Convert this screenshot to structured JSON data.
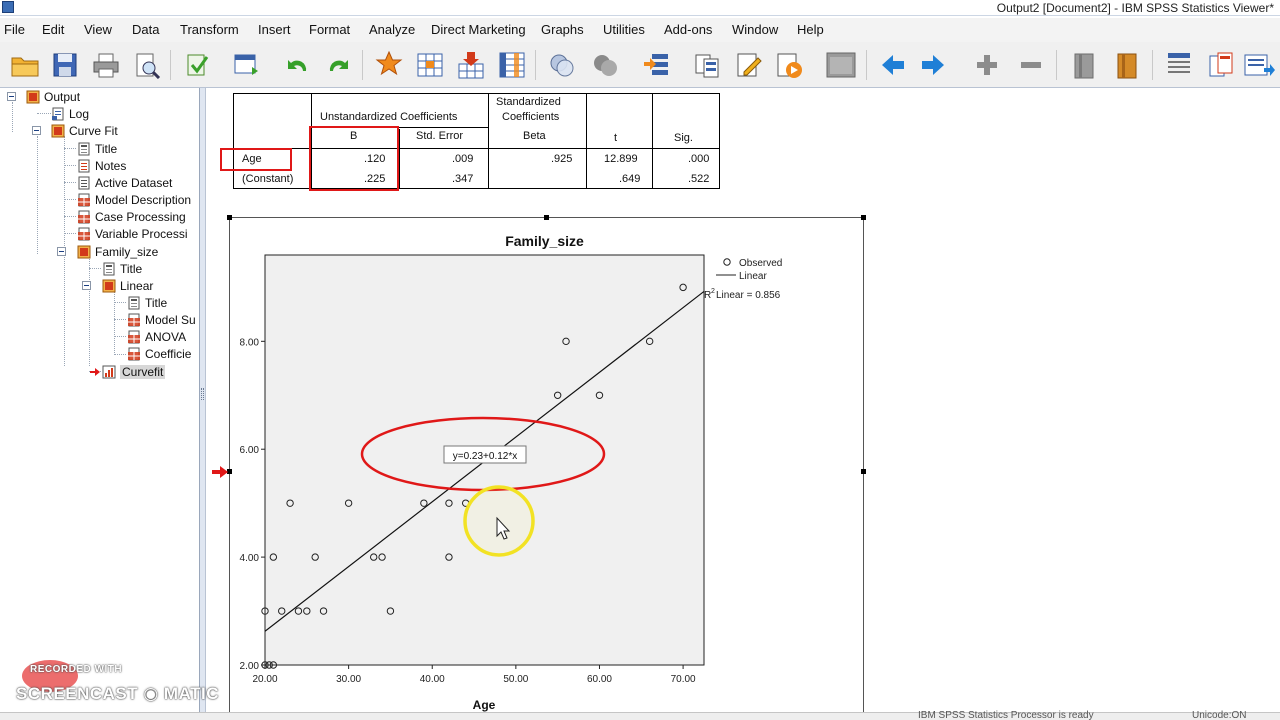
{
  "window": {
    "title": "Output2 [Document2] - IBM SPSS Statistics Viewer*"
  },
  "menu": [
    "File",
    "Edit",
    "View",
    "Data",
    "Transform",
    "Insert",
    "Format",
    "Analyze",
    "Direct Marketing",
    "Graphs",
    "Utilities",
    "Add-ons",
    "Window",
    "Help"
  ],
  "toolbar_icons": [
    "open-icon",
    "save-icon",
    "print-icon",
    "print-preview-icon",
    "export-icon",
    "goto-data-icon",
    "undo-icon",
    "redo-icon",
    "goto-case-icon",
    "goto-variable-icon",
    "insert-cases-icon",
    "variables-icon",
    "select-cases-icon",
    "value-labels-icon",
    "use-sets-icon",
    "show-all-variables-icon",
    "spelling-icon",
    "run-script-icon",
    "designate-window-icon",
    "previous-icon",
    "next-icon",
    "expand-icon",
    "collapse-icon",
    "show-icon",
    "hide-icon",
    "insert-heading-icon",
    "insert-title-icon",
    "insert-text-icon"
  ],
  "outline": {
    "nodes": [
      {
        "label": "Output",
        "icon": "output-book-icon"
      },
      {
        "label": "Log",
        "icon": "log-icon"
      },
      {
        "label": "Curve Fit",
        "icon": "procedure-book-icon"
      },
      {
        "label": "Title",
        "icon": "title-icon"
      },
      {
        "label": "Notes",
        "icon": "notes-icon"
      },
      {
        "label": "Active Dataset",
        "icon": "dataset-icon"
      },
      {
        "label": "Model Description",
        "icon": "table-icon"
      },
      {
        "label": "Case Processing",
        "icon": "table-icon"
      },
      {
        "label": "Variable Processi",
        "icon": "table-icon"
      },
      {
        "label": "Family_size",
        "icon": "procedure-book-icon"
      },
      {
        "label": "Title",
        "icon": "title-icon"
      },
      {
        "label": "Linear",
        "icon": "procedure-book-icon"
      },
      {
        "label": "Title",
        "icon": "title-icon"
      },
      {
        "label": "Model Su",
        "icon": "table-icon"
      },
      {
        "label": "ANOVA",
        "icon": "table-icon"
      },
      {
        "label": "Coefficie",
        "icon": "table-icon"
      },
      {
        "label": "Curvefit",
        "icon": "chart-icon"
      }
    ]
  },
  "coefficients_table": {
    "header_unstd": "Unstandardized Coefficients",
    "header_std_1": "Standardized",
    "header_std_2": "Coefficients",
    "col_b": "B",
    "col_se": "Std. Error",
    "col_beta": "Beta",
    "col_t": "t",
    "col_sig": "Sig.",
    "rows": [
      {
        "label": "Age",
        "b": ".120",
        "se": ".009",
        "beta": ".925",
        "t": "12.899",
        "sig": ".000"
      },
      {
        "label": "(Constant)",
        "b": ".225",
        "se": ".347",
        "beta": "",
        "t": ".649",
        "sig": ".522"
      }
    ]
  },
  "chart_data": {
    "type": "scatter",
    "title": "Family_size",
    "xlabel": "Age",
    "ylabel": "",
    "xlim": [
      20,
      72.5
    ],
    "ylim": [
      2,
      9.6
    ],
    "xticks": [
      "20.00",
      "30.00",
      "40.00",
      "50.00",
      "60.00",
      "70.00"
    ],
    "yticks": [
      "2.00",
      "4.00",
      "6.00",
      "8.00"
    ],
    "xtick_values": [
      20,
      30,
      40,
      50,
      60,
      70
    ],
    "ytick_values": [
      2,
      4,
      6,
      8
    ],
    "legend": {
      "observed": "Observed",
      "linear": "Linear",
      "r2_prefix": "R",
      "r2_sup": "2",
      "r2_text": " Linear = 0.856",
      "position": "right"
    },
    "fit_label": "y=0.23+0.12*x",
    "fit": {
      "intercept": 0.225,
      "slope": 0.12
    },
    "series": [
      {
        "name": "Observed",
        "points": [
          [
            20,
            2
          ],
          [
            20.5,
            2
          ],
          [
            21,
            2
          ],
          [
            20,
            3
          ],
          [
            22,
            3
          ],
          [
            24,
            3
          ],
          [
            25,
            3
          ],
          [
            27,
            3
          ],
          [
            35,
            3
          ],
          [
            21,
            4
          ],
          [
            26,
            4
          ],
          [
            33,
            4
          ],
          [
            34,
            4
          ],
          [
            42,
            4
          ],
          [
            23,
            5
          ],
          [
            30,
            5
          ],
          [
            39,
            5
          ],
          [
            42,
            5
          ],
          [
            44,
            5
          ],
          [
            45,
            6
          ],
          [
            46,
            6
          ],
          [
            55,
            7
          ],
          [
            60,
            7
          ],
          [
            56,
            8
          ],
          [
            66,
            8
          ],
          [
            70,
            9
          ]
        ]
      }
    ]
  },
  "status": {
    "processor": "IBM SPSS Statistics Processor is ready",
    "unicode": "Unicode:ON"
  },
  "watermark": {
    "top": "RECORDED WITH",
    "main": "SCREENCAST ◉ MATIC"
  }
}
